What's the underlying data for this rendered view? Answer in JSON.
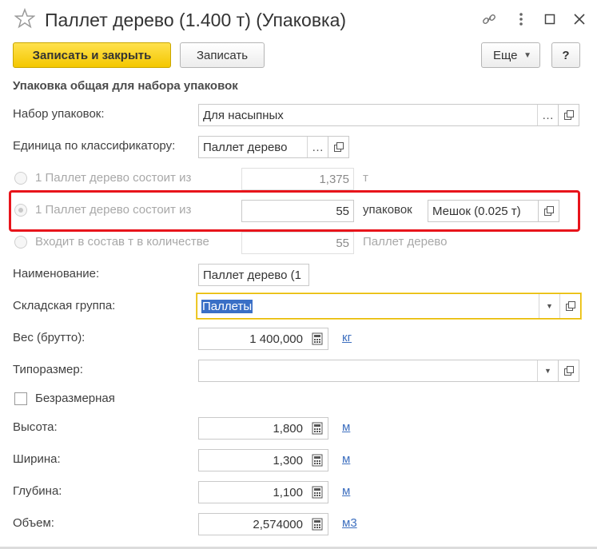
{
  "window": {
    "title": "Паллет дерево (1.400 т) (Упаковка)",
    "icons": [
      "star-icon",
      "link-icon",
      "more-icon",
      "maximize-icon",
      "close-icon"
    ]
  },
  "toolbar": {
    "save_close_label": "Записать и закрыть",
    "save_label": "Записать",
    "more_label": "Еще",
    "help_label": "?"
  },
  "section": {
    "title": "Упаковка общая для набора упаковок"
  },
  "form": {
    "package_set": {
      "label": "Набор упаковок:",
      "value": "Для насыпных"
    },
    "classifier_unit": {
      "label": "Единица по классификатору:",
      "value": "Паллет дерево"
    },
    "option1": {
      "label": "1 Паллет дерево состоит из",
      "value": "1,375",
      "unit": "т"
    },
    "option2": {
      "label": "1 Паллет дерево состоит из",
      "value": "55",
      "unit": "упаковок",
      "package": "Мешок (0.025 т)"
    },
    "option3": {
      "label": "Входит в состав т в количестве",
      "value": "55",
      "unit": "Паллет дерево"
    },
    "name": {
      "label": "Наименование:",
      "value": "Паллет дерево (1"
    },
    "warehouse_group": {
      "label": "Складская группа:",
      "value": "Паллеты"
    },
    "weight": {
      "label": "Вес (брутто):",
      "value": "1 400,000",
      "unit": "кг"
    },
    "size_type": {
      "label": "Типоразмер:",
      "value": ""
    },
    "sizeless": {
      "label": "Безразмерная",
      "checked": false
    },
    "height": {
      "label": "Высота:",
      "value": "1,800",
      "unit": "м"
    },
    "width": {
      "label": "Ширина:",
      "value": "1,300",
      "unit": "м"
    },
    "depth": {
      "label": "Глубина:",
      "value": "1,100",
      "unit": "м"
    },
    "volume": {
      "label": "Объем:",
      "value": "2,574000",
      "unit": "м3"
    }
  },
  "colors": {
    "primary_button": "#f4c700",
    "highlight_frame": "#e8141b",
    "link": "#3d6fbf",
    "selection": "#3a6fc6"
  }
}
